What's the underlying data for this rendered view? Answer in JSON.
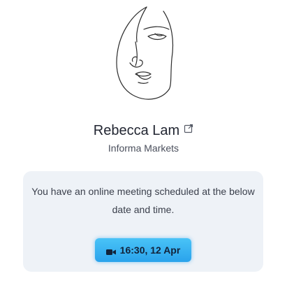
{
  "profile": {
    "avatar_icon": "line-art-face-icon",
    "name": "Rebecca Lam",
    "name_link_icon": "external-link-icon",
    "company": "Informa Markets"
  },
  "meeting": {
    "message": "You have an online meeting scheduled at the below date and time.",
    "button_icon": "video-camera-icon",
    "button_label": "16:30, 12 Apr",
    "accent_color": "#2aa3ec"
  }
}
